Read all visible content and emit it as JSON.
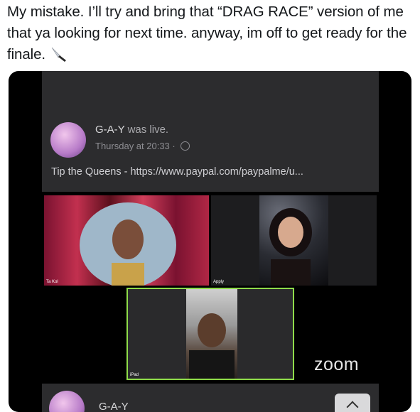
{
  "tweet": {
    "text": "My mistake. I’ll try and bring that “DRAG RACE” version of me that ya looking for next time. anyway, im off to get ready for the finale."
  },
  "post": {
    "author": "G-A-Y",
    "status": "was live.",
    "time": "Thursday at 20:33 ·",
    "description": "Tip the Queens - https://www.paypal.com/paypalme/u..."
  },
  "tiles": [
    {
      "label": "Ta Kol"
    },
    {
      "label": "Apply"
    },
    {
      "label": "iPad"
    }
  ],
  "zoom_label": "zoom",
  "bottom": {
    "author": "G-A-Y"
  }
}
